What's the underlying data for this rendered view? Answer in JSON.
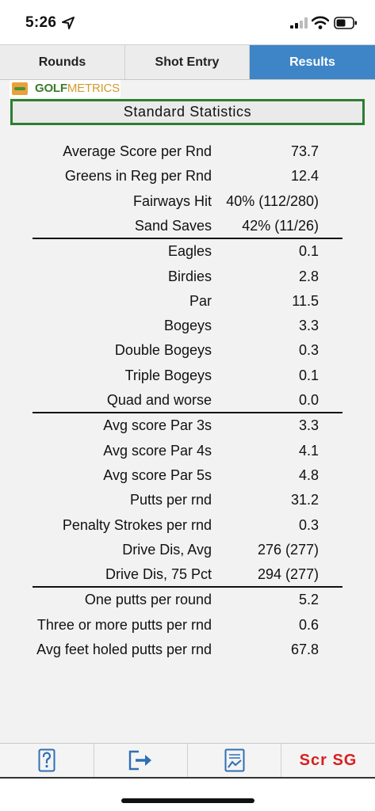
{
  "status_bar": {
    "time": "5:26"
  },
  "tabs": [
    {
      "label": "Rounds",
      "active": false
    },
    {
      "label": "Shot Entry",
      "active": false
    },
    {
      "label": "Results",
      "active": true
    }
  ],
  "logo": {
    "part1": "GOLF",
    "part2": "METRICS"
  },
  "section": {
    "title": "Standard Statistics"
  },
  "stats": [
    {
      "label": "Average Score per Rnd",
      "value": "73.7"
    },
    {
      "label": "Greens in Reg per Rnd",
      "value": "12.4"
    },
    {
      "label": "Fairways Hit",
      "value": "40% (112/280)"
    },
    {
      "label": "Sand Saves",
      "value": "42% (11/26)"
    },
    {
      "label": "Eagles",
      "value": "0.1"
    },
    {
      "label": "Birdies",
      "value": "2.8"
    },
    {
      "label": "Par",
      "value": "11.5"
    },
    {
      "label": "Bogeys",
      "value": "3.3"
    },
    {
      "label": "Double Bogeys",
      "value": "0.3"
    },
    {
      "label": "Triple Bogeys",
      "value": "0.1"
    },
    {
      "label": "Quad and worse",
      "value": "0.0"
    },
    {
      "label": "Avg score Par 3s",
      "value": "3.3"
    },
    {
      "label": "Avg score Par 4s",
      "value": "4.1"
    },
    {
      "label": "Avg score Par 5s",
      "value": "4.8"
    },
    {
      "label": "Putts per rnd",
      "value": "31.2"
    },
    {
      "label": "Penalty Strokes per rnd",
      "value": "0.3"
    },
    {
      "label": "Drive Dis, Avg",
      "value": "276 (277)"
    },
    {
      "label": "Drive Dis, 75 Pct",
      "value": "294 (277)"
    },
    {
      "label": "One putts per round",
      "value": "5.2"
    },
    {
      "label": "Three or more putts per rnd",
      "value": "0.6"
    },
    {
      "label": "Avg feet holed putts per rnd",
      "value": "67.8"
    }
  ],
  "toolbar": {
    "items": [
      {
        "icon": "help-icon"
      },
      {
        "icon": "export-icon"
      },
      {
        "icon": "chart-report-icon"
      },
      {
        "label": "Scr SG"
      }
    ]
  },
  "colors": {
    "accent": "#3d85c6",
    "header_border": "#2e7d32",
    "scr_red": "#d81f1f"
  }
}
